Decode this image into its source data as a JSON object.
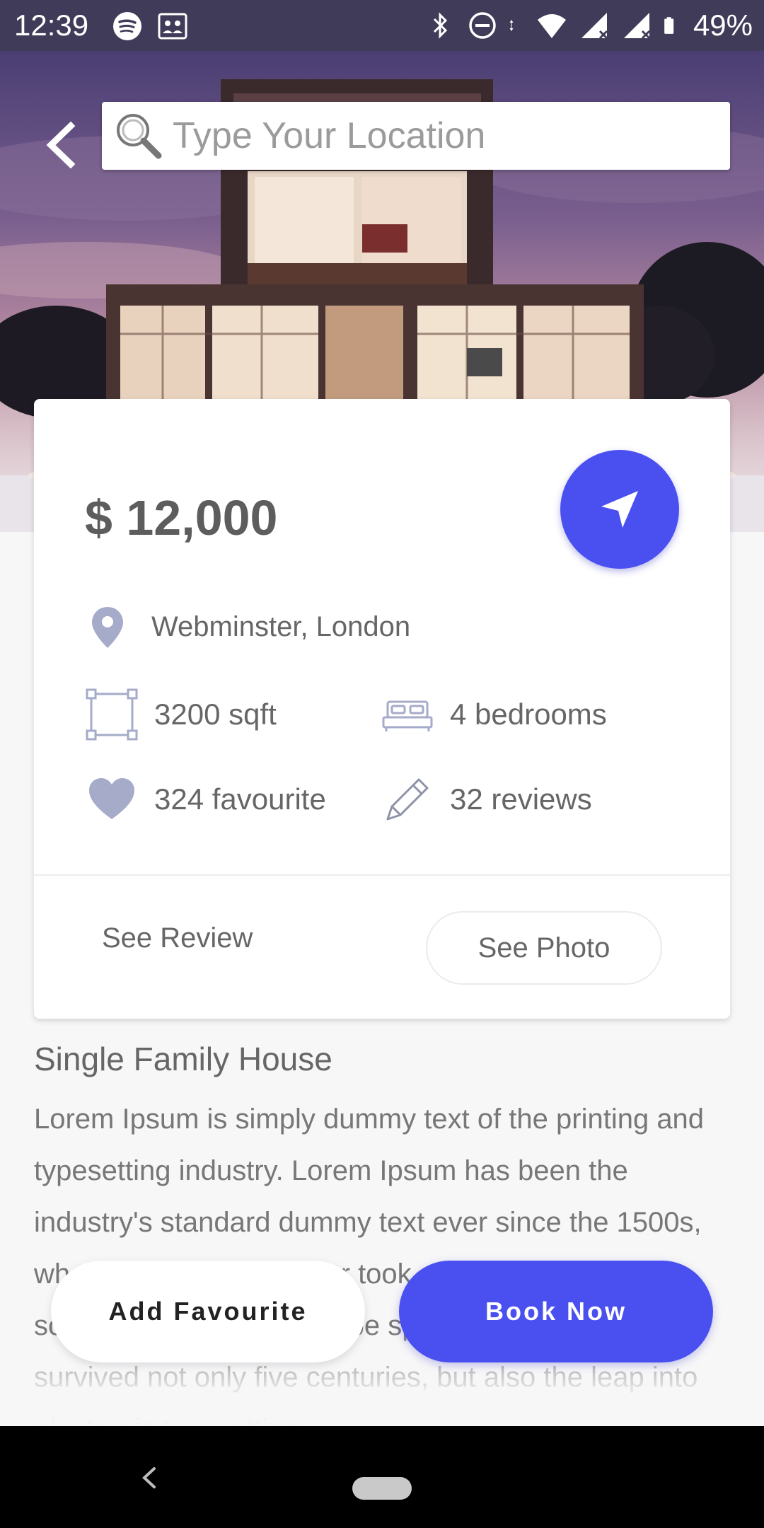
{
  "status_bar": {
    "time": "12:39",
    "battery": "49%",
    "left_icons": [
      "spotify-icon",
      "photos-icon"
    ],
    "right_icons": [
      "bluetooth-icon",
      "dnd-icon",
      "data-arrows-icon",
      "wifi-icon",
      "signal-icon",
      "signal-icon",
      "battery-icon"
    ]
  },
  "search": {
    "placeholder": "Type Your Location",
    "value": ""
  },
  "card": {
    "price": "$ 12,000",
    "location": "Webminster, London",
    "area": "3200 sqft",
    "bedrooms": "4 bedrooms",
    "favourites": "324 favourite",
    "reviews": "32 reviews",
    "see_review_label": "See Review",
    "see_photo_label": "See Photo"
  },
  "description": {
    "title": "Single Family House",
    "body": "Lorem Ipsum is simply dummy text of the printing and typesetting industry. Lorem Ipsum has been the industry's standard dummy text ever since the 1500s, when an unknown printer took a galley of type and scrambled it to make a type specimen book. It has survived not only five centuries, but also the leap into electronic typesetting."
  },
  "actions": {
    "add_favourite": "Add Favourite",
    "book_now": "Book Now"
  },
  "colors": {
    "accent": "#4a50ef",
    "status_bar": "#3f3b58",
    "icon_muted": "#a5abc8"
  }
}
